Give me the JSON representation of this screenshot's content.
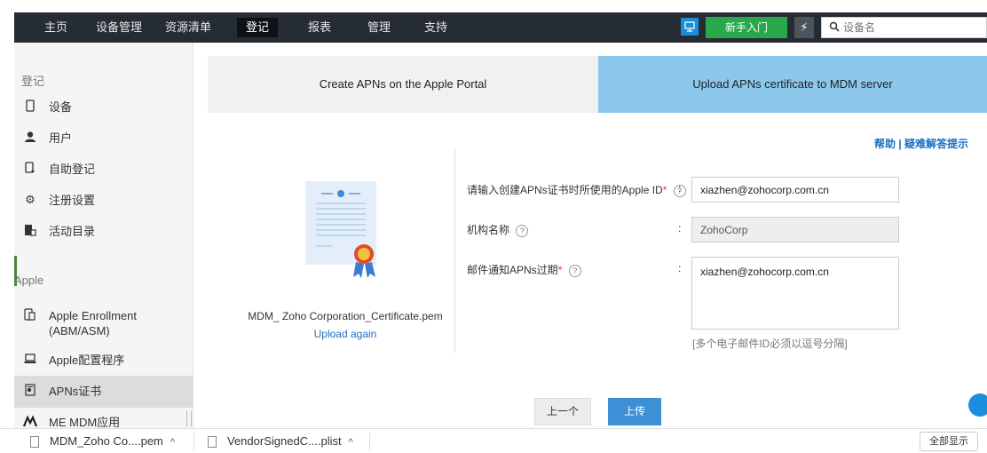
{
  "nav": {
    "items": [
      "主页",
      "设备管理",
      "资源清单",
      "登记",
      "报表",
      "管理",
      "支持"
    ],
    "active_index": 3,
    "screen_icon": "screen-icon",
    "getting_started": "新手入门",
    "bolt_icon": "bolt-icon",
    "search_placeholder": "设备名"
  },
  "sidebar": {
    "section_enroll": "登记",
    "items": [
      {
        "label": "设备",
        "icon": "phone-icon"
      },
      {
        "label": "用户",
        "icon": "user-icon"
      },
      {
        "label": "自助登记",
        "icon": "self-enroll-icon"
      },
      {
        "label": "注册设置",
        "icon": "gear-icon"
      },
      {
        "label": "活动目录",
        "icon": "directory-icon"
      }
    ],
    "section_apple": "Apple",
    "apple_items": [
      {
        "label": "Apple Enrollment",
        "label2": "(ABM/ASM)",
        "icon": "devices-icon"
      },
      {
        "label": "Apple配置程序",
        "icon": "laptop-icon"
      },
      {
        "label": "APNs证书",
        "icon": "certificate-icon",
        "active": true
      },
      {
        "label": "ME MDM应用",
        "icon": "app-icon"
      }
    ]
  },
  "steps": {
    "step1": "Create APNs on the Apple Portal",
    "step2": "Upload APNs certificate to MDM server",
    "active": 2
  },
  "links": {
    "help": "帮助",
    "separator": " | ",
    "troubleshoot": "疑难解答提示"
  },
  "certificate": {
    "filename": "MDM_ Zoho Corporation_Certificate.pem",
    "upload_again": "Upload again"
  },
  "form": {
    "apple_id_label": "请输入创建APNs证书时所使用的Apple ID",
    "apple_id_value": "xiazhen@zohocorp.com.cn",
    "org_label": "机构名称",
    "org_value": "ZohoCorp",
    "email_label": "邮件通知APNs过期",
    "email_value": "xiazhen@zohocorp.com.cn",
    "email_hint": "[多个电子邮件ID必须以逗号分隔]",
    "required_mark": "*",
    "help_mark": "?",
    "colon": ":"
  },
  "buttons": {
    "prev": "上一个",
    "upload": "上传"
  },
  "downloads": {
    "items": [
      "MDM_Zoho Co....pem",
      "VendorSignedC....plist"
    ],
    "show_all": "全部显示"
  },
  "colors": {
    "nav_bg": "#262c34",
    "green": "#26a84b",
    "active_step": "#8cc8ec",
    "link": "#1a6fc0",
    "primary": "#3d8fd6"
  }
}
